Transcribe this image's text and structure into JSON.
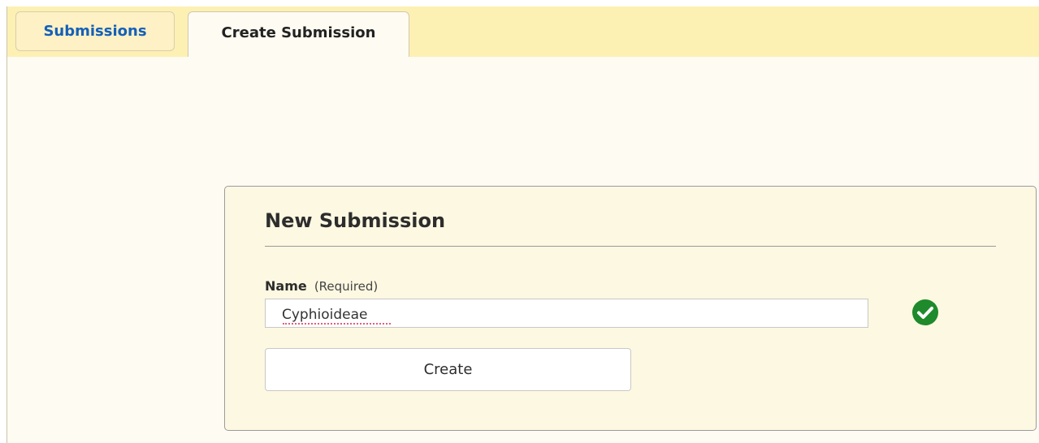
{
  "tabs": {
    "submissions_label": "Submissions",
    "create_label": "Create Submission"
  },
  "form": {
    "title": "New Submission",
    "name_label": "Name",
    "name_hint": "(Required)",
    "name_value": "Cyphioideae",
    "create_label": "Create",
    "valid_icon": "check-circle-icon"
  },
  "colors": {
    "tabbar_bg": "#fdf0b3",
    "link_blue": "#1560b8",
    "valid_green": "#1e8a2b"
  }
}
